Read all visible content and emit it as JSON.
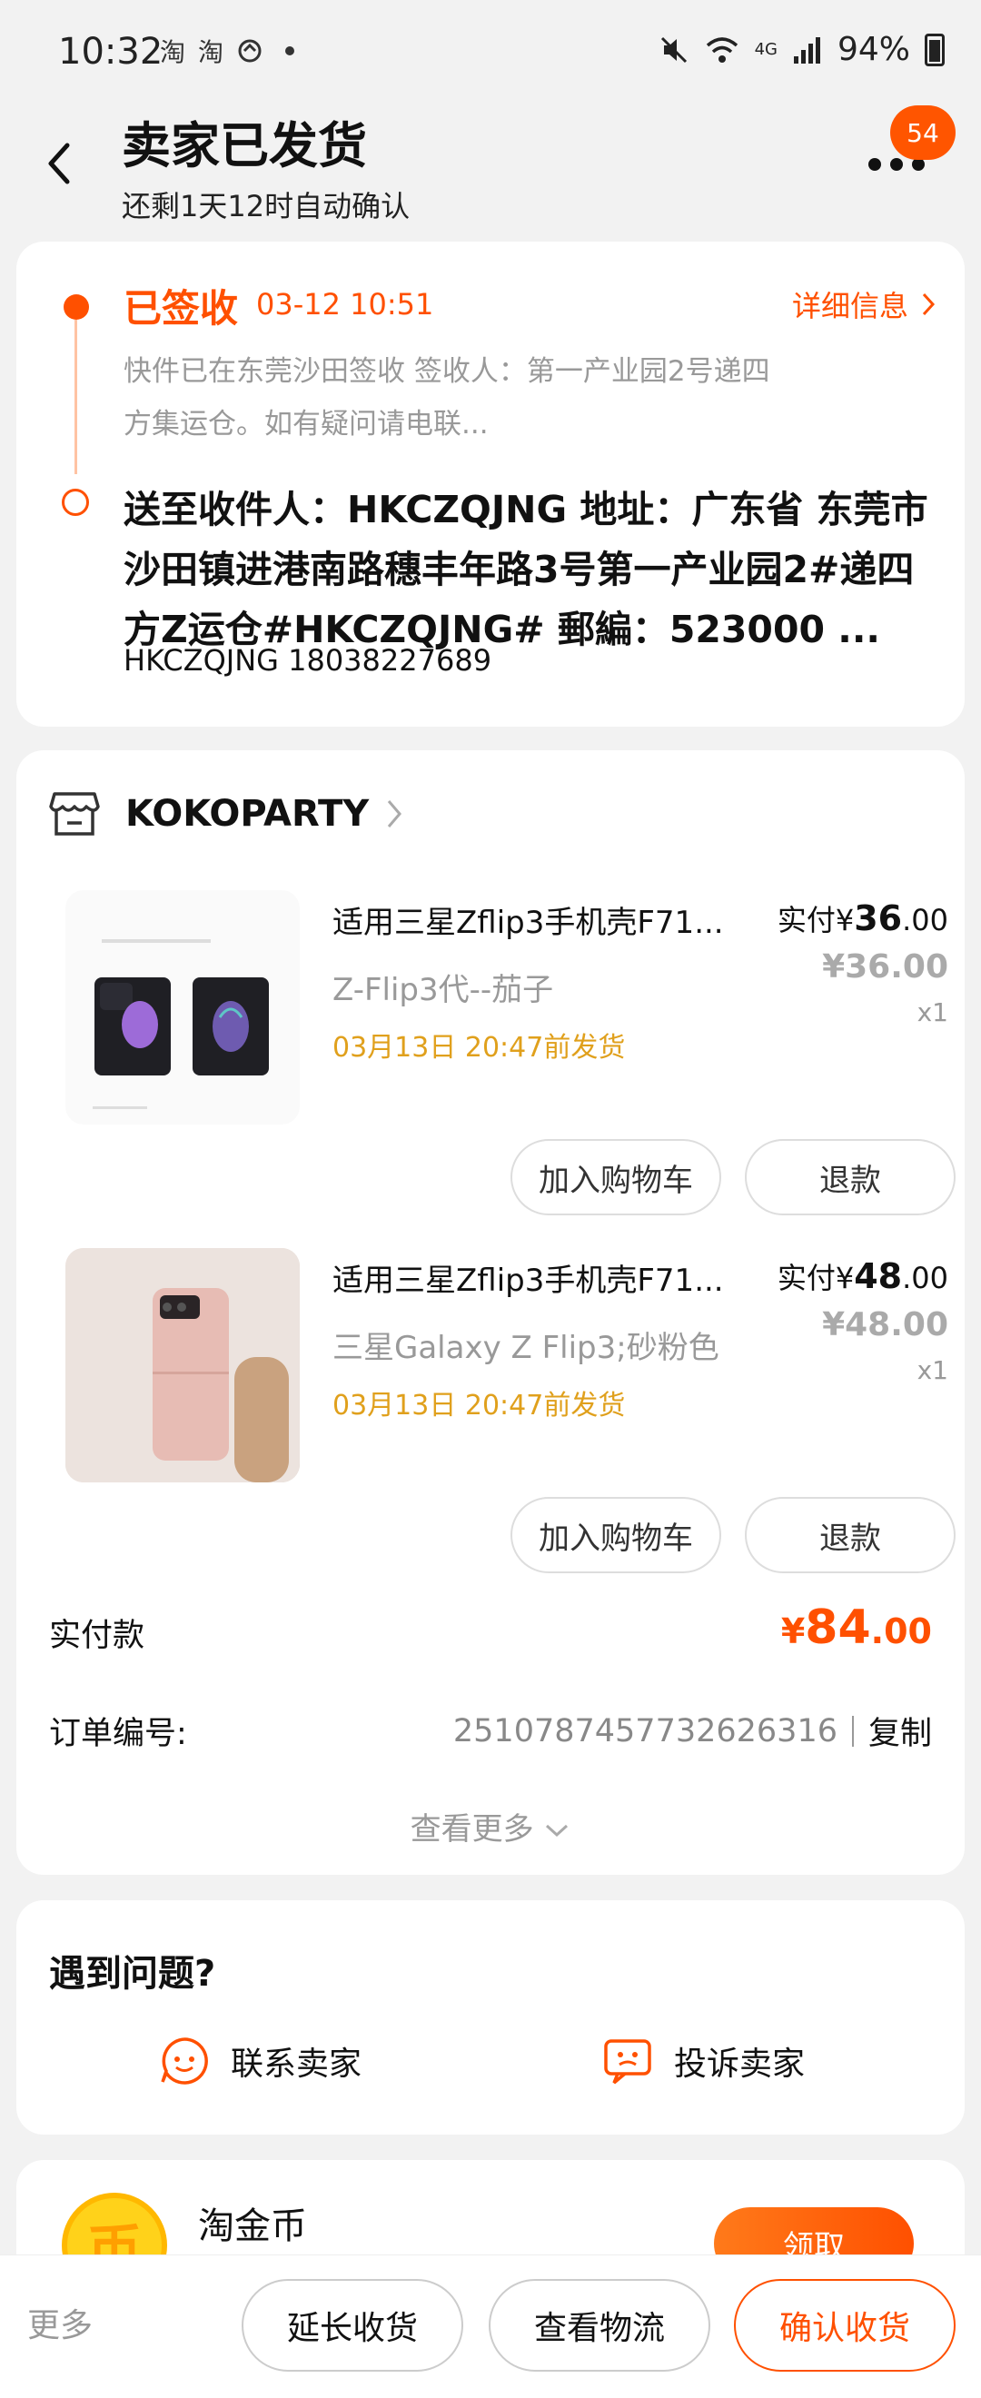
{
  "status_bar": {
    "time": "10:32",
    "app_icons": [
      "淘",
      "淘"
    ],
    "network": "4G",
    "battery": "94%"
  },
  "header": {
    "title": "卖家已发货",
    "subtitle": "还剩1天12时自动确认",
    "message_count": "54"
  },
  "logistics": {
    "status": "已签收",
    "time": "03-12 10:51",
    "detail_link": "详细信息",
    "description": "快件已在东莞沙田签收 签收人：第一产业园2号递四方集运仓。如有疑问请电联...",
    "address": "送至收件人：HKCZQJNG 地址：广东省 东莞市 沙田镇进港南路穗丰年路3号第一产业园2#递四方Z运仓#HKCZQJNG# 郵編：523000 ...",
    "contact": "HKCZQJNG 18038227689"
  },
  "order": {
    "shop_name": "KOKOPARTY",
    "items": [
      {
        "title": "适用三星Zflip3手机壳F71...",
        "spec": "Z-Flip3代--茄子",
        "ship": "03月13日 20:47前发货",
        "pay_label": "实付",
        "currency": "¥",
        "price_int": "36",
        "price_dec": ".00",
        "orig_price": "¥36.00",
        "qty": "x1",
        "cart_label": "加入购物车",
        "refund_label": "退款"
      },
      {
        "title": "适用三星Zflip3手机壳F71...",
        "spec": "三星Galaxy Z Flip3;砂粉色",
        "ship": "03月13日 20:47前发货",
        "pay_label": "实付",
        "currency": "¥",
        "price_int": "48",
        "price_dec": ".00",
        "orig_price": "¥48.00",
        "qty": "x1",
        "cart_label": "加入购物车",
        "refund_label": "退款"
      }
    ],
    "total_label": "实付款",
    "total_currency": "¥",
    "total_int": "84",
    "total_dec": ".00",
    "order_no_label": "订单编号:",
    "order_no": "2510787457732626316",
    "copy_label": "复制",
    "see_more": "查看更多"
  },
  "problems": {
    "title": "遇到问题?",
    "contact_seller": "联系卖家",
    "complain_seller": "投诉卖家"
  },
  "coin": {
    "icon_char": "币",
    "title": "淘金币",
    "button": "领取"
  },
  "bottom_bar": {
    "more": "更多",
    "extend": "延长收货",
    "logistics": "查看物流",
    "confirm": "确认收货"
  },
  "colors": {
    "accent": "#ff5000",
    "ship_text": "#e0a01c"
  }
}
